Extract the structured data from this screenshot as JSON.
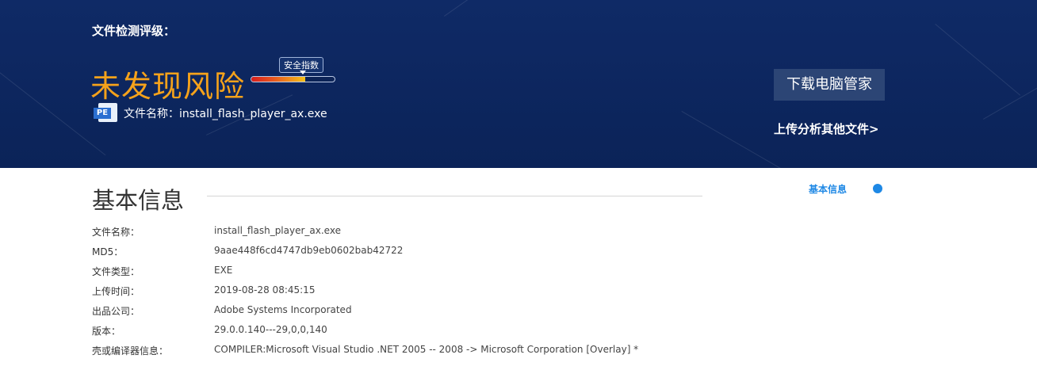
{
  "banner": {
    "rating_label": "文件检测评级：",
    "verdict": "未发现风险",
    "verdict_color": "#f5a21b",
    "safety_index_label": "安全指数",
    "safety_index_level": 0.65,
    "file_icon": "pe-file-icon",
    "file_icon_text": "PE",
    "file_name_label": "文件名称：",
    "file_name": "install_flash_player_ax.exe",
    "download_button": "下载电脑管家",
    "upload_link": "上传分析其他文件>"
  },
  "basic_info": {
    "title": "基本信息",
    "side_nav_label": "基本信息",
    "accent_color": "#1e88e5",
    "rows": [
      {
        "label": "文件名称：",
        "value": "install_flash_player_ax.exe"
      },
      {
        "label": "MD5：",
        "value": "9aae448f6cd4747db9eb0602bab42722"
      },
      {
        "label": "文件类型：",
        "value": "EXE"
      },
      {
        "label": "上传时间：",
        "value": "2019-08-28 08:45:15"
      },
      {
        "label": "出品公司：",
        "value": "Adobe Systems Incorporated"
      },
      {
        "label": "版本：",
        "value": "29.0.0.140---29,0,0,140"
      },
      {
        "label": "壳或编译器信息：",
        "value": "COMPILER:Microsoft Visual Studio .NET 2005 -- 2008 -> Microsoft Corporation [Overlay] *"
      }
    ]
  }
}
